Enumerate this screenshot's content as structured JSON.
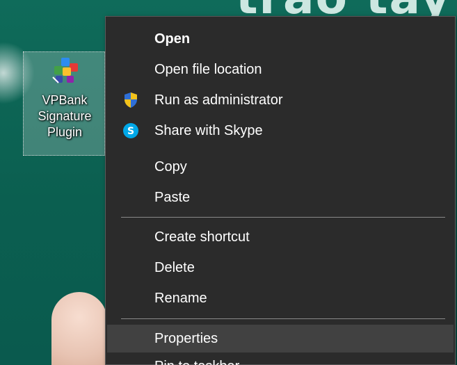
{
  "desktop": {
    "wallpaper_text": "trao tay",
    "icon": {
      "label": "VPBank\nSignature\nPlugin",
      "icon_name": "puzzle-plugin-icon"
    }
  },
  "context_menu": {
    "items": [
      {
        "label": "Open",
        "bold": true,
        "icon": null
      },
      {
        "label": "Open file location",
        "bold": false,
        "icon": null
      },
      {
        "label": "Run as administrator",
        "bold": false,
        "icon": "uac-shield-icon"
      },
      {
        "label": "Share with Skype",
        "bold": false,
        "icon": "skype-icon"
      },
      {
        "label": "Copy",
        "bold": false,
        "icon": null
      },
      {
        "label": "Paste",
        "bold": false,
        "icon": null
      },
      {
        "label": "Create shortcut",
        "bold": false,
        "icon": null
      },
      {
        "label": "Delete",
        "bold": false,
        "icon": null
      },
      {
        "label": "Rename",
        "bold": false,
        "icon": null
      },
      {
        "label": "Properties",
        "bold": false,
        "icon": null,
        "highlighted": true
      }
    ],
    "partial_item": "Pin to taskbar"
  },
  "colors": {
    "menu_background": "#2b2b2b",
    "menu_highlight": "#414141",
    "separator": "#8a8a8a",
    "desktop_background": "#0b5f50",
    "skype_blue": "#00a8e8",
    "shield_blue": "#2f6fd6",
    "shield_yellow": "#f2c21b"
  }
}
